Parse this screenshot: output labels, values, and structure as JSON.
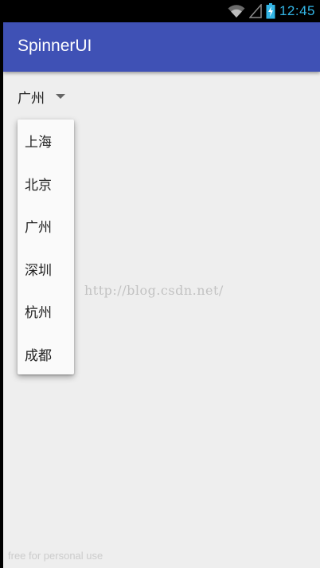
{
  "status_bar": {
    "time": "12:45",
    "icons": [
      "wifi-icon",
      "signal-icon",
      "battery-charging-icon"
    ],
    "accent": "#33b5e5"
  },
  "toolbar": {
    "title": "SpinnerUI",
    "color": "#3f51b5"
  },
  "spinner": {
    "selected": "广州"
  },
  "dropdown": {
    "items": [
      "上海",
      "北京",
      "广州",
      "深圳",
      "杭州",
      "成都"
    ]
  },
  "watermarks": {
    "url": "http://blog.csdn.net/",
    "footer": "free for personal use"
  }
}
